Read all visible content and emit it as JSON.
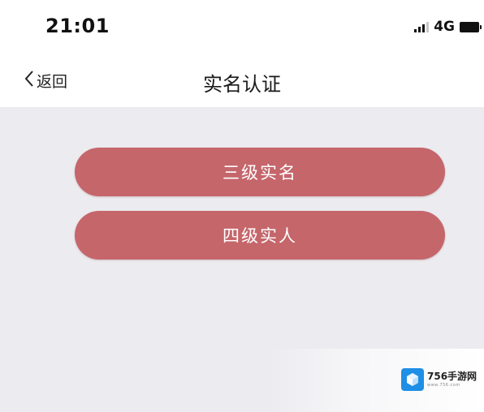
{
  "status_bar": {
    "time": "21:01",
    "network": "4G",
    "signal_icon": "signal-bars-icon",
    "battery_icon": "battery-icon"
  },
  "nav": {
    "back_label": "返回",
    "back_icon": "chevron-left-icon",
    "title": "实名认证"
  },
  "options": [
    {
      "label": "三级实名"
    },
    {
      "label": "四级实人"
    }
  ],
  "watermark": {
    "brand": "756手游网",
    "url": "www.756.com",
    "logo_icon": "cube-logo-icon"
  },
  "colors": {
    "accent": "#c5666b",
    "content_bg": "#ececf0",
    "watermark_logo": "#1e8fe6"
  }
}
